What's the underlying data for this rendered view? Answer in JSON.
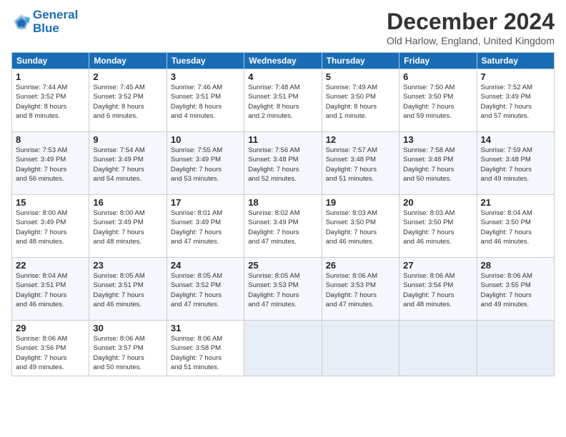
{
  "header": {
    "logo_line1": "General",
    "logo_line2": "Blue",
    "title": "December 2024",
    "location": "Old Harlow, England, United Kingdom"
  },
  "weekdays": [
    "Sunday",
    "Monday",
    "Tuesday",
    "Wednesday",
    "Thursday",
    "Friday",
    "Saturday"
  ],
  "weeks": [
    [
      {
        "day": 1,
        "info": "Sunrise: 7:44 AM\nSunset: 3:52 PM\nDaylight: 8 hours\nand 8 minutes."
      },
      {
        "day": 2,
        "info": "Sunrise: 7:45 AM\nSunset: 3:52 PM\nDaylight: 8 hours\nand 6 minutes."
      },
      {
        "day": 3,
        "info": "Sunrise: 7:46 AM\nSunset: 3:51 PM\nDaylight: 8 hours\nand 4 minutes."
      },
      {
        "day": 4,
        "info": "Sunrise: 7:48 AM\nSunset: 3:51 PM\nDaylight: 8 hours\nand 2 minutes."
      },
      {
        "day": 5,
        "info": "Sunrise: 7:49 AM\nSunset: 3:50 PM\nDaylight: 8 hours\nand 1 minute."
      },
      {
        "day": 6,
        "info": "Sunrise: 7:50 AM\nSunset: 3:50 PM\nDaylight: 7 hours\nand 59 minutes."
      },
      {
        "day": 7,
        "info": "Sunrise: 7:52 AM\nSunset: 3:49 PM\nDaylight: 7 hours\nand 57 minutes."
      }
    ],
    [
      {
        "day": 8,
        "info": "Sunrise: 7:53 AM\nSunset: 3:49 PM\nDaylight: 7 hours\nand 56 minutes."
      },
      {
        "day": 9,
        "info": "Sunrise: 7:54 AM\nSunset: 3:49 PM\nDaylight: 7 hours\nand 54 minutes."
      },
      {
        "day": 10,
        "info": "Sunrise: 7:55 AM\nSunset: 3:49 PM\nDaylight: 7 hours\nand 53 minutes."
      },
      {
        "day": 11,
        "info": "Sunrise: 7:56 AM\nSunset: 3:48 PM\nDaylight: 7 hours\nand 52 minutes."
      },
      {
        "day": 12,
        "info": "Sunrise: 7:57 AM\nSunset: 3:48 PM\nDaylight: 7 hours\nand 51 minutes."
      },
      {
        "day": 13,
        "info": "Sunrise: 7:58 AM\nSunset: 3:48 PM\nDaylight: 7 hours\nand 50 minutes."
      },
      {
        "day": 14,
        "info": "Sunrise: 7:59 AM\nSunset: 3:48 PM\nDaylight: 7 hours\nand 49 minutes."
      }
    ],
    [
      {
        "day": 15,
        "info": "Sunrise: 8:00 AM\nSunset: 3:49 PM\nDaylight: 7 hours\nand 48 minutes."
      },
      {
        "day": 16,
        "info": "Sunrise: 8:00 AM\nSunset: 3:49 PM\nDaylight: 7 hours\nand 48 minutes."
      },
      {
        "day": 17,
        "info": "Sunrise: 8:01 AM\nSunset: 3:49 PM\nDaylight: 7 hours\nand 47 minutes."
      },
      {
        "day": 18,
        "info": "Sunrise: 8:02 AM\nSunset: 3:49 PM\nDaylight: 7 hours\nand 47 minutes."
      },
      {
        "day": 19,
        "info": "Sunrise: 8:03 AM\nSunset: 3:50 PM\nDaylight: 7 hours\nand 46 minutes."
      },
      {
        "day": 20,
        "info": "Sunrise: 8:03 AM\nSunset: 3:50 PM\nDaylight: 7 hours\nand 46 minutes."
      },
      {
        "day": 21,
        "info": "Sunrise: 8:04 AM\nSunset: 3:50 PM\nDaylight: 7 hours\nand 46 minutes."
      }
    ],
    [
      {
        "day": 22,
        "info": "Sunrise: 8:04 AM\nSunset: 3:51 PM\nDaylight: 7 hours\nand 46 minutes."
      },
      {
        "day": 23,
        "info": "Sunrise: 8:05 AM\nSunset: 3:51 PM\nDaylight: 7 hours\nand 46 minutes."
      },
      {
        "day": 24,
        "info": "Sunrise: 8:05 AM\nSunset: 3:52 PM\nDaylight: 7 hours\nand 47 minutes."
      },
      {
        "day": 25,
        "info": "Sunrise: 8:05 AM\nSunset: 3:53 PM\nDaylight: 7 hours\nand 47 minutes."
      },
      {
        "day": 26,
        "info": "Sunrise: 8:06 AM\nSunset: 3:53 PM\nDaylight: 7 hours\nand 47 minutes."
      },
      {
        "day": 27,
        "info": "Sunrise: 8:06 AM\nSunset: 3:54 PM\nDaylight: 7 hours\nand 48 minutes."
      },
      {
        "day": 28,
        "info": "Sunrise: 8:06 AM\nSunset: 3:55 PM\nDaylight: 7 hours\nand 49 minutes."
      }
    ],
    [
      {
        "day": 29,
        "info": "Sunrise: 8:06 AM\nSunset: 3:56 PM\nDaylight: 7 hours\nand 49 minutes."
      },
      {
        "day": 30,
        "info": "Sunrise: 8:06 AM\nSunset: 3:57 PM\nDaylight: 7 hours\nand 50 minutes."
      },
      {
        "day": 31,
        "info": "Sunrise: 8:06 AM\nSunset: 3:58 PM\nDaylight: 7 hours\nand 51 minutes."
      },
      null,
      null,
      null,
      null
    ]
  ]
}
